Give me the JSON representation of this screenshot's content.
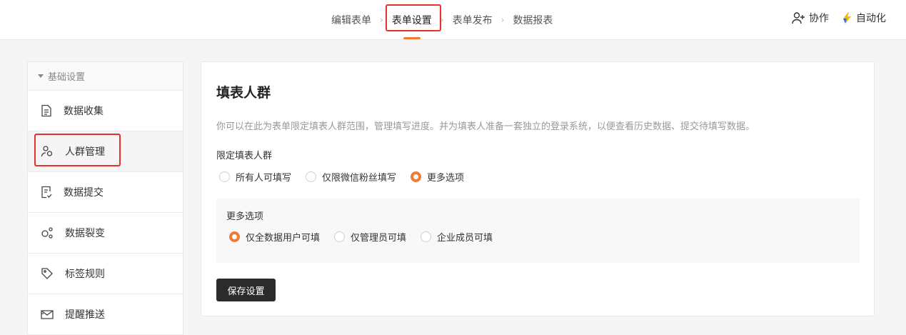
{
  "steps": [
    {
      "label": "编辑表单"
    },
    {
      "label": "表单设置"
    },
    {
      "label": "表单发布"
    },
    {
      "label": "数据报表"
    }
  ],
  "header_actions": {
    "collaborate": "协作",
    "automation": "自动化"
  },
  "sidebar": {
    "group": "基础设置",
    "items": [
      {
        "label": "数据收集"
      },
      {
        "label": "人群管理"
      },
      {
        "label": "数据提交"
      },
      {
        "label": "数据裂变"
      },
      {
        "label": "标签规则"
      },
      {
        "label": "提醒推送"
      }
    ]
  },
  "panel": {
    "title": "填表人群",
    "description": "你可以在此为表单限定填表人群范围，管理填写进度。并为填表人准备一套独立的登录系统，以便查看历史数据、提交待填写数据。",
    "restrict_label": "限定填表人群",
    "restrict_options": [
      {
        "label": "所有人可填写",
        "checked": false
      },
      {
        "label": "仅限微信粉丝填写",
        "checked": false
      },
      {
        "label": "更多选项",
        "checked": true
      }
    ],
    "more_label": "更多选项",
    "more_options": [
      {
        "label": "仅全数据用户可填",
        "checked": true
      },
      {
        "label": "仅管理员可填",
        "checked": false
      },
      {
        "label": "企业成员可填",
        "checked": false
      }
    ],
    "save_label": "保存设置"
  },
  "colors": {
    "accent": "#f07b36",
    "highlight": "#e5322d",
    "button": "#2b2b2b"
  }
}
